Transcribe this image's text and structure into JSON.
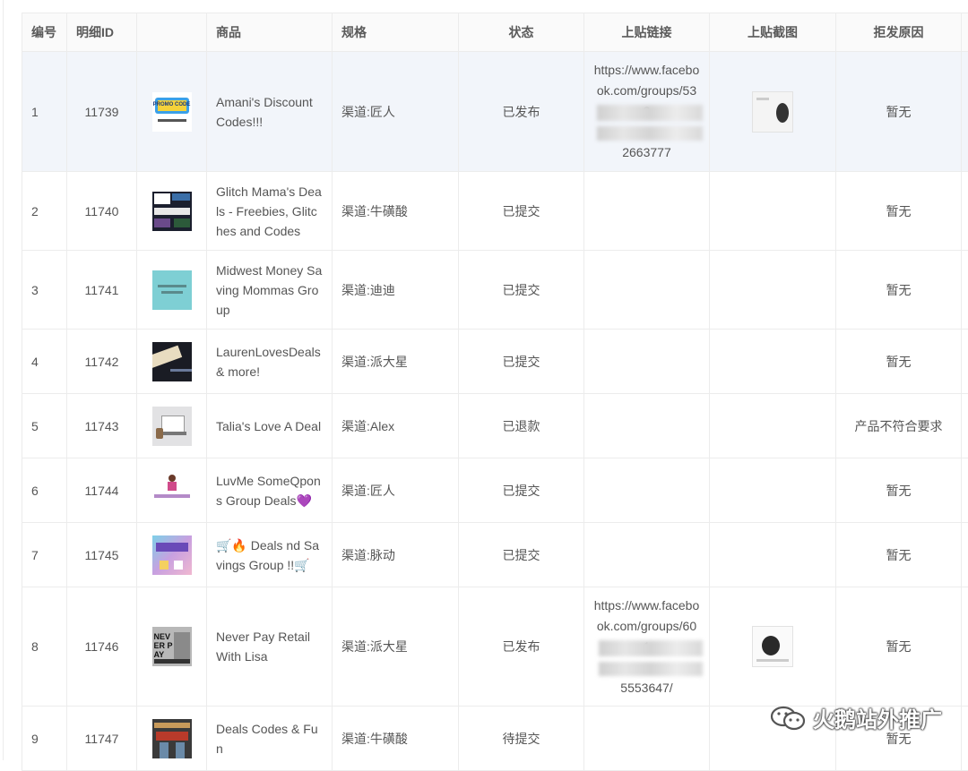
{
  "table": {
    "headers": [
      "编号",
      "明细ID",
      "",
      "商品",
      "规格",
      "状态",
      "上贴链接",
      "上贴截图",
      "拒发原因"
    ],
    "rows": [
      {
        "num": "1",
        "id": "11739",
        "product": "Amani's Discount Codes!!!",
        "spec": "渠道:匠人",
        "status": "已发布",
        "link_top": "https://www.facebook.com/groups/532",
        "link_bottom": "2663777",
        "reason": "暂无"
      },
      {
        "num": "2",
        "id": "11740",
        "product": "Glitch Mama's Deals - Freebies, Glitches and Codes",
        "spec": "渠道:牛磺酸",
        "status": "已提交",
        "link_top": "",
        "link_bottom": "",
        "reason": "暂无"
      },
      {
        "num": "3",
        "id": "11741",
        "product": "Midwest Money Saving Mommas Group",
        "spec": "渠道:迪迪",
        "status": "已提交",
        "link_top": "",
        "link_bottom": "",
        "reason": "暂无"
      },
      {
        "num": "4",
        "id": "11742",
        "product": "LaurenLovesDeals & more!",
        "spec": "渠道:派大星",
        "status": "已提交",
        "link_top": "",
        "link_bottom": "",
        "reason": "暂无"
      },
      {
        "num": "5",
        "id": "11743",
        "product": "Talia's Love A Deal",
        "spec": "渠道:Alex",
        "status": "已退款",
        "link_top": "",
        "link_bottom": "",
        "reason": "产品不符合要求"
      },
      {
        "num": "6",
        "id": "11744",
        "product": "LuvMe SomeQpons Group Deals💜",
        "spec": "渠道:匠人",
        "status": "已提交",
        "link_top": "",
        "link_bottom": "",
        "reason": "暂无"
      },
      {
        "num": "7",
        "id": "11745",
        "product": "🛒🔥 Deals nd Savings Group !!🛒",
        "spec": "渠道:脉动",
        "status": "已提交",
        "link_top": "",
        "link_bottom": "",
        "reason": "暂无"
      },
      {
        "num": "8",
        "id": "11746",
        "product": "Never Pay Retail With Lisa",
        "spec": "渠道:派大星",
        "status": "已发布",
        "link_top": "https://www.facebook.com/groups/601",
        "link_bottom": "5553647/",
        "reason": "暂无"
      },
      {
        "num": "9",
        "id": "11747",
        "product": "Deals Codes & Fun",
        "spec": "渠道:牛磺酸",
        "status": "待提交",
        "link_top": "",
        "link_bottom": "",
        "reason": "暂无"
      }
    ]
  },
  "thumbs": {
    "r1": "PROMO CODE",
    "r8": "NEVER PAY"
  },
  "watermark": {
    "text": "火鹅站外推广"
  },
  "colors": {
    "border": "#ececec",
    "header_bg": "#fafafa",
    "highlight_row": "#f2f5fa"
  }
}
